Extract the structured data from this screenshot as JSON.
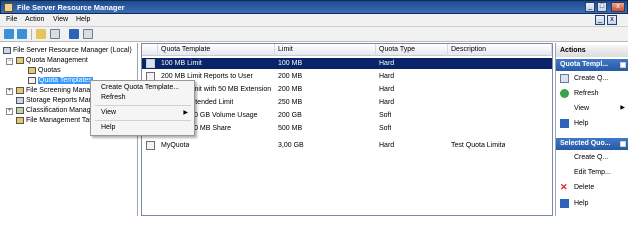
{
  "window": {
    "title": "File Server Resource Manager"
  },
  "menu": {
    "file": "File",
    "action": "Action",
    "view": "View",
    "help": "Help"
  },
  "tree": {
    "root": "File Server Resource Manager (Local)",
    "quota_management": "Quota Management",
    "quotas": "Quotas",
    "quota_templates": "Quota Templates",
    "file_screening": "File Screening Manag",
    "storage_reports": "Storage Reports Mar",
    "classification": "Classification Manage",
    "file_management": "File Management Tas"
  },
  "context_menu": {
    "create": "Create Quota Template...",
    "refresh": "Refresh",
    "view": "View",
    "help": "Help"
  },
  "list": {
    "columns": [
      "Quota Template",
      "Limit",
      "Quota Type",
      "Description"
    ],
    "rows": [
      {
        "name": "100 MB Limit",
        "limit": "100 MB",
        "type": "Hard",
        "description": ""
      },
      {
        "name": "200 MB Limit Reports to User",
        "limit": "200 MB",
        "type": "Hard",
        "description": ""
      },
      {
        "name": "200 MB Limit with 50 MB Extension",
        "limit": "200 MB",
        "type": "Hard",
        "description": ""
      },
      {
        "name": "250 MB Extended Limit",
        "limit": "250 MB",
        "type": "Hard",
        "description": ""
      },
      {
        "name": "Monitor 200 GB Volume Usage",
        "limit": "200 GB",
        "type": "Soft",
        "description": ""
      },
      {
        "name": "Monitor 500 MB Share",
        "limit": "500 MB",
        "type": "Soft",
        "description": ""
      },
      {
        "name": "MyQuota",
        "limit": "3,00 GB",
        "type": "Hard",
        "description": "Test Quota Limita"
      }
    ]
  },
  "actions": {
    "title": "Actions",
    "section1": "Quota Templ...",
    "create": "Create Q...",
    "refresh": "Refresh",
    "view": "View",
    "help": "Help",
    "section2": "Selected Quo...",
    "create2": "Create Q...",
    "edit": "Edit Temp...",
    "delete": "Delete",
    "help2": "Help"
  },
  "colors": {
    "selection": "#0a246a",
    "tree_selection": "#3399ff",
    "title_bar": "#2a5aa0"
  }
}
